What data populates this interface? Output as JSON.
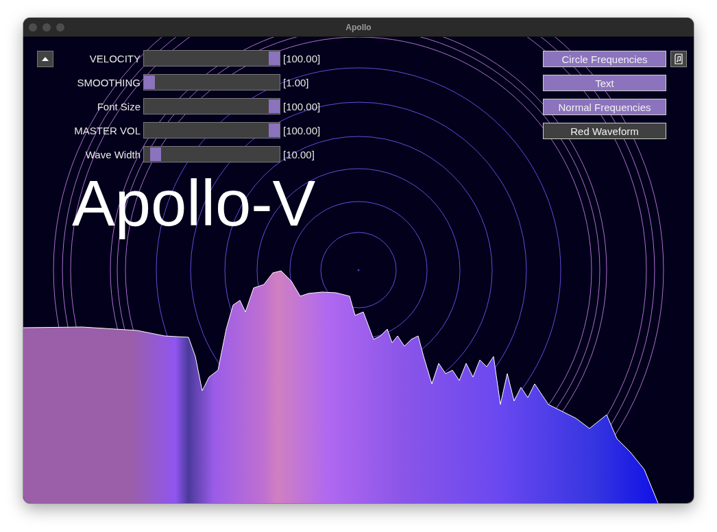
{
  "window": {
    "title": "Apollo"
  },
  "sliders": [
    {
      "label": "VELOCITY",
      "level": 1,
      "reading": "[100.00]"
    },
    {
      "label": "SMOOTHING",
      "level": 0,
      "reading": "[1.00]"
    },
    {
      "label": "Font Size",
      "level": 1,
      "reading": "[100.00]"
    },
    {
      "label": "MASTER VOL",
      "level": 1,
      "reading": "[100.00]"
    },
    {
      "label": "Wave Width",
      "level": 0.05,
      "reading": "[10.00]"
    }
  ],
  "toggles": [
    {
      "label": "Circle Frequencies",
      "on": true
    },
    {
      "label": "Text",
      "on": true
    },
    {
      "label": "Normal Frequencies",
      "on": true
    },
    {
      "label": "Red Waveform",
      "on": false
    }
  ],
  "heading": "Apollo-V"
}
